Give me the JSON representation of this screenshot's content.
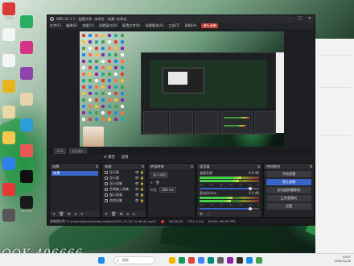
{
  "window": {
    "title": "OBS 31.1.1 - 配置文件: 未命名 - 场景: 未命名",
    "controls": [
      "–",
      "□",
      "✕"
    ]
  },
  "menu": [
    "文件(F)",
    "编辑(E)",
    "查看(V)",
    "停靠窗口(D)",
    "配置文件(P)",
    "场景集合(S)",
    "工具(T)",
    "帮助(H)",
    "进行录制"
  ],
  "zoom": {
    "value": "10%",
    "mode": "适应窗口"
  },
  "scenebar": {
    "properties": "⚙ 属性",
    "filters": "滤镜"
  },
  "docks": {
    "scenes": {
      "title": "场景",
      "items": [
        "场景"
      ]
    },
    "sources": {
      "title": "来源",
      "items": [
        "显示器",
        "显示器",
        "显示采集",
        "音频输入采集",
        "窗口采集",
        "游戏采集"
      ]
    },
    "audio": {
      "title": "转场特效",
      "transition": "淡入淡出",
      "duration_label": "时长",
      "duration": "300 ms"
    },
    "mixer": {
      "title": "混音器",
      "channels": [
        {
          "name": "桌面音频",
          "db": "0.0 dB",
          "level": 0.7,
          "gain": 0.85
        },
        {
          "name": "麦克风/Aux",
          "db": "0.0 dB",
          "level": 0.55,
          "gain": 0.85
        }
      ],
      "ticks": [
        "-60",
        "-50",
        "-40",
        "-30",
        "-20",
        "-10",
        "0"
      ]
    },
    "controls": {
      "title": "控制按钮",
      "buttons": [
        "开始直播",
        "停止录制",
        "启动虚拟摄像机",
        "工作室模式",
        "设置"
      ],
      "active_index": 1
    }
  },
  "status": {
    "message": "录像保存到 \"C:/Users/Administrator/Videos/2025-12-30 13-06-44.mp4\"",
    "cpu": "CPU: 0.1%",
    "fps": "60.00 / 60.00 FPS",
    "time": "00:00:00"
  },
  "watermark": "OOK 406666",
  "desktop_icons": [
    {
      "label": "Crops",
      "color": "#d93a3a"
    },
    {
      "label": "",
      "color": "#f5f5f5"
    },
    {
      "label": "",
      "color": "#f5f5f5"
    },
    {
      "label": "",
      "color": "#e8b41d"
    },
    {
      "label": "",
      "color": "#e9d8a6"
    },
    {
      "label": "",
      "color": "#f2c94c"
    },
    {
      "label": "",
      "color": "#2f80ed"
    },
    {
      "label": "",
      "color": "#e53935"
    },
    {
      "label": "",
      "color": "#555555"
    },
    {
      "label": "",
      "color": "#27ae60"
    },
    {
      "label": "",
      "color": "#d63384"
    },
    {
      "label": "",
      "color": "#8e44ad"
    },
    {
      "label": "",
      "color": "#e8d3b0"
    },
    {
      "label": "",
      "color": "#2d9cdb"
    },
    {
      "label": "",
      "color": "#eb5757"
    },
    {
      "label": "",
      "color": "#111111"
    },
    {
      "label": "Armoury",
      "color": "#1a1a1a"
    }
  ],
  "taskbar": {
    "search_placeholder": "搜索",
    "time": "13:07",
    "date": "2025/12/30",
    "apps": [
      {
        "color": "#1e88e5"
      },
      {
        "color": "#f4b400"
      },
      {
        "color": "#0f9d58"
      },
      {
        "color": "#db4437"
      },
      {
        "color": "#4285f4"
      },
      {
        "color": "#00897b"
      },
      {
        "color": "#616161"
      },
      {
        "color": "#8e24aa"
      },
      {
        "color": "#303030"
      },
      {
        "color": "#1e88e5"
      },
      {
        "color": "#43a047"
      }
    ]
  },
  "colors": {
    "accent": "#3a64c8",
    "obs_bg": "#1e1f22",
    "record_dot": "#d33333"
  }
}
